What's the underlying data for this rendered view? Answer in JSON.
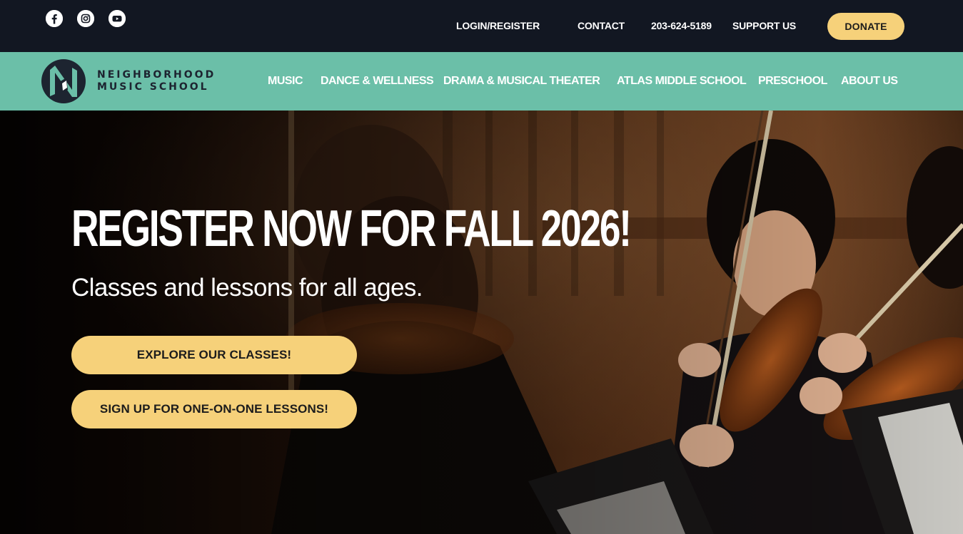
{
  "topbar": {
    "social": [
      {
        "icon": "facebook-icon"
      },
      {
        "icon": "instagram-icon"
      },
      {
        "icon": "youtube-icon"
      }
    ],
    "links": {
      "login": "LOGIN/REGISTER",
      "contact": "CONTACT",
      "phone": "203-624-5189",
      "support": "SUPPORT US"
    },
    "donate_label": "DONATE"
  },
  "brand": {
    "line1": "NEIGHBORHOOD",
    "line2": "MUSIC SCHOOL"
  },
  "nav": {
    "items": [
      {
        "label": "MUSIC"
      },
      {
        "label": "DANCE & WELLNESS"
      },
      {
        "label": "DRAMA & MUSICAL THEATER"
      },
      {
        "label": "ATLAS MIDDLE SCHOOL"
      },
      {
        "label": "PRESCHOOL"
      },
      {
        "label": "ABOUT US"
      }
    ]
  },
  "hero": {
    "title": "REGISTER NOW FOR FALL 2026!",
    "subtitle": "Classes and lessons for all ages.",
    "cta_primary": "EXPLORE OUR CLASSES!",
    "cta_secondary": "SIGN UP FOR ONE-ON-ONE LESSONS!"
  },
  "colors": {
    "topbar_bg": "#121722",
    "nav_bg": "#6bbfa8",
    "button_bg": "#f6d17a",
    "logo_dark": "#1d2430"
  }
}
